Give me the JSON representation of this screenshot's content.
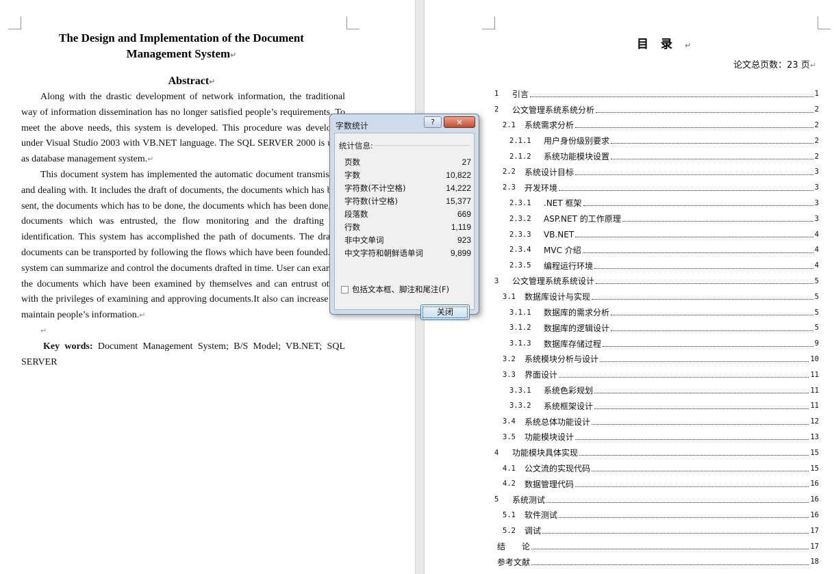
{
  "left_page": {
    "title": "The Design and Implementation of the Document Management System",
    "abstract_heading": "Abstract",
    "paragraph1": "Along with the drastic development of network information, the traditional way of information dissemination has no longer satisfied people’s requirements. To meet the above needs, this system is developed. This procedure was developed under Visual Studio 2003 with VB.NET language. The SQL SERVER 2000 is used as database management system.",
    "paragraph2": "This document system has implemented the automatic document transmission and dealing with. It includes the draft of documents, the documents which has been sent, the documents which has to be done, the documents which has been done, the documents which was entrusted, the flow monitoring and the drafting unit identification. This system has accomplished the path of documents. The drafted documents can be transported by following the flows which have been founded.The system can summarize and control the documents drafted in time. User can examine the documents which have been examined by themselves and can entrust others with the privileges of examining and approving documents.It also can increase and maintain people’s information.",
    "keywords_label": "Key words:",
    "keywords": "Document Management System; B/S Model; VB.NET; SQL SERVER",
    "return_mark": "↵"
  },
  "right_page": {
    "toc_title": "目录",
    "total_pages": "论文总页数：23 页",
    "toc": [
      {
        "num": "1",
        "label": "引言",
        "page": "1",
        "indent": 0
      },
      {
        "num": "2",
        "label": "公文管理系统系统分析",
        "page": "2",
        "indent": 0
      },
      {
        "num": "2.1",
        "label": "系统需求分析",
        "page": "2",
        "indent": 1
      },
      {
        "num": "2.1.1",
        "label": "用户身份级别要求",
        "page": "2",
        "indent": 2
      },
      {
        "num": "2.1.2",
        "label": "系统功能模块设置",
        "page": "2",
        "indent": 2
      },
      {
        "num": "2.2",
        "label": "系统设计目标",
        "page": "3",
        "indent": 1
      },
      {
        "num": "2.3",
        "label": "开发环境",
        "page": "3",
        "indent": 1
      },
      {
        "num": "2.3.1",
        "label": ".NET 框架",
        "page": "3",
        "indent": 2
      },
      {
        "num": "2.3.2",
        "label": "ASP.NET 的工作原理",
        "page": "3",
        "indent": 2
      },
      {
        "num": "2.3.3",
        "label": "VB.NET",
        "page": "4",
        "indent": 2
      },
      {
        "num": "2.3.4",
        "label": "MVC 介绍",
        "page": "4",
        "indent": 2
      },
      {
        "num": "2.3.5",
        "label": "编程运行环境",
        "page": "4",
        "indent": 2
      },
      {
        "num": "3",
        "label": "公文管理系统系统设计",
        "page": "5",
        "indent": 0
      },
      {
        "num": "3.1",
        "label": "数据库设计与实现",
        "page": "5",
        "indent": 1
      },
      {
        "num": "3.1.1",
        "label": "数据库的需求分析",
        "page": "5",
        "indent": 2
      },
      {
        "num": "3.1.2",
        "label": "数据库的逻辑设计",
        "page": "5",
        "indent": 2
      },
      {
        "num": "3.1.3",
        "label": "数据库存储过程",
        "page": "9",
        "indent": 2
      },
      {
        "num": "3.2",
        "label": "系统模块分析与设计",
        "page": "10",
        "indent": 1
      },
      {
        "num": "3.3",
        "label": "界面设计",
        "page": "11",
        "indent": 1
      },
      {
        "num": "3.3.1",
        "label": "系统色彩规划",
        "page": "11",
        "indent": 2
      },
      {
        "num": "3.3.2",
        "label": "系统框架设计",
        "page": "11",
        "indent": 2
      },
      {
        "num": "3.4",
        "label": "系统总体功能设计",
        "page": "12",
        "indent": 1
      },
      {
        "num": "3.5",
        "label": "功能模块设计",
        "page": "13",
        "indent": 1
      },
      {
        "num": "4",
        "label": "功能模块具体实现",
        "page": "15",
        "indent": 0
      },
      {
        "num": "4.1",
        "label": "公文流的实现代码",
        "page": "15",
        "indent": 1
      },
      {
        "num": "4.2",
        "label": "数据管理代码",
        "page": "16",
        "indent": 1
      },
      {
        "num": "5",
        "label": "系统测试",
        "page": "16",
        "indent": 0
      },
      {
        "num": "5.1",
        "label": "软件测试",
        "page": "16",
        "indent": 1
      },
      {
        "num": "5.2",
        "label": "调试",
        "page": "17",
        "indent": 1
      },
      {
        "num": "",
        "label": "结　　论",
        "page": "17",
        "indent": 0
      },
      {
        "num": "",
        "label": "参考文献",
        "page": "18",
        "indent": 0
      }
    ]
  },
  "dialog": {
    "title": "字数统计",
    "help_label": "?",
    "close_x_label": "✕",
    "group_label": "统计信息:",
    "stats": [
      {
        "label": "页数",
        "value": "27"
      },
      {
        "label": "字数",
        "value": "10,822"
      },
      {
        "label": "字符数(不计空格)",
        "value": "14,222"
      },
      {
        "label": "字符数(计空格)",
        "value": "15,377"
      },
      {
        "label": "段落数",
        "value": "669"
      },
      {
        "label": "行数",
        "value": "1,119"
      },
      {
        "label": "非中文单词",
        "value": "923"
      },
      {
        "label": "中文字符和朝鲜语单词",
        "value": "9,899"
      }
    ],
    "checkbox_label": "包括文本框、脚注和尾注(F)",
    "checkbox_checked": false,
    "close_button_label": "关闭"
  }
}
